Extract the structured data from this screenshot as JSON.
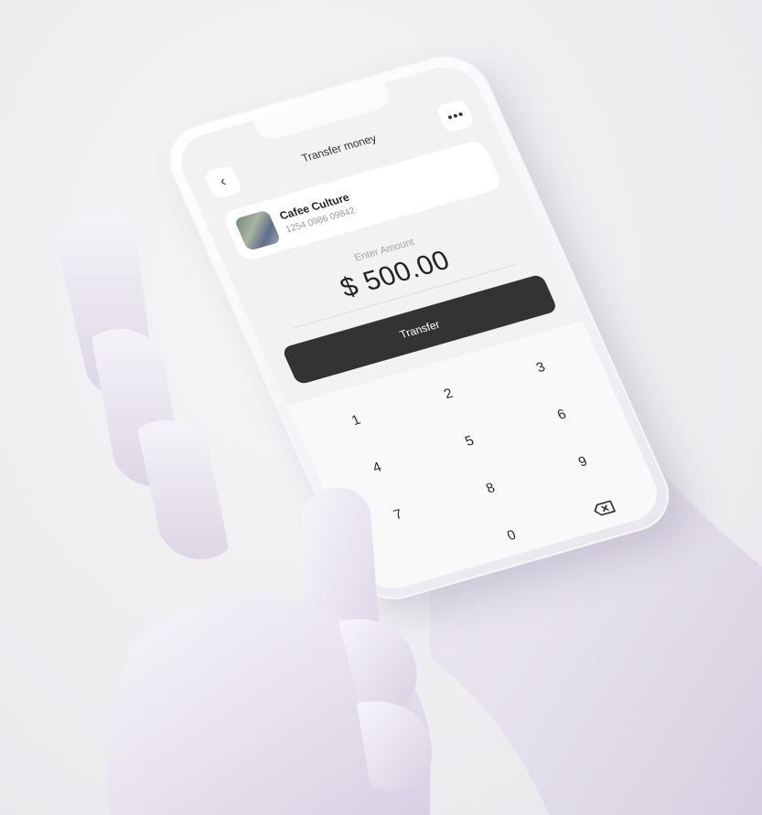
{
  "header": {
    "title": "Transfer money"
  },
  "recipient": {
    "name": "Cafee Culture",
    "account": "1254 0986 09842"
  },
  "amount": {
    "label": "Enter Amount",
    "value": "$ 500.00"
  },
  "actions": {
    "transfer_label": "Transfer"
  },
  "keypad": {
    "keys": [
      "1",
      "2",
      "3",
      "4",
      "5",
      "6",
      "7",
      "8",
      "9",
      "0"
    ]
  },
  "icons": {
    "back": "chevron-left-icon",
    "more": "more-dots-icon",
    "delete": "backspace-icon"
  },
  "colors": {
    "primary_button": "#333335",
    "screen_bg": "#f2f2f4",
    "card_bg": "#ffffff"
  }
}
